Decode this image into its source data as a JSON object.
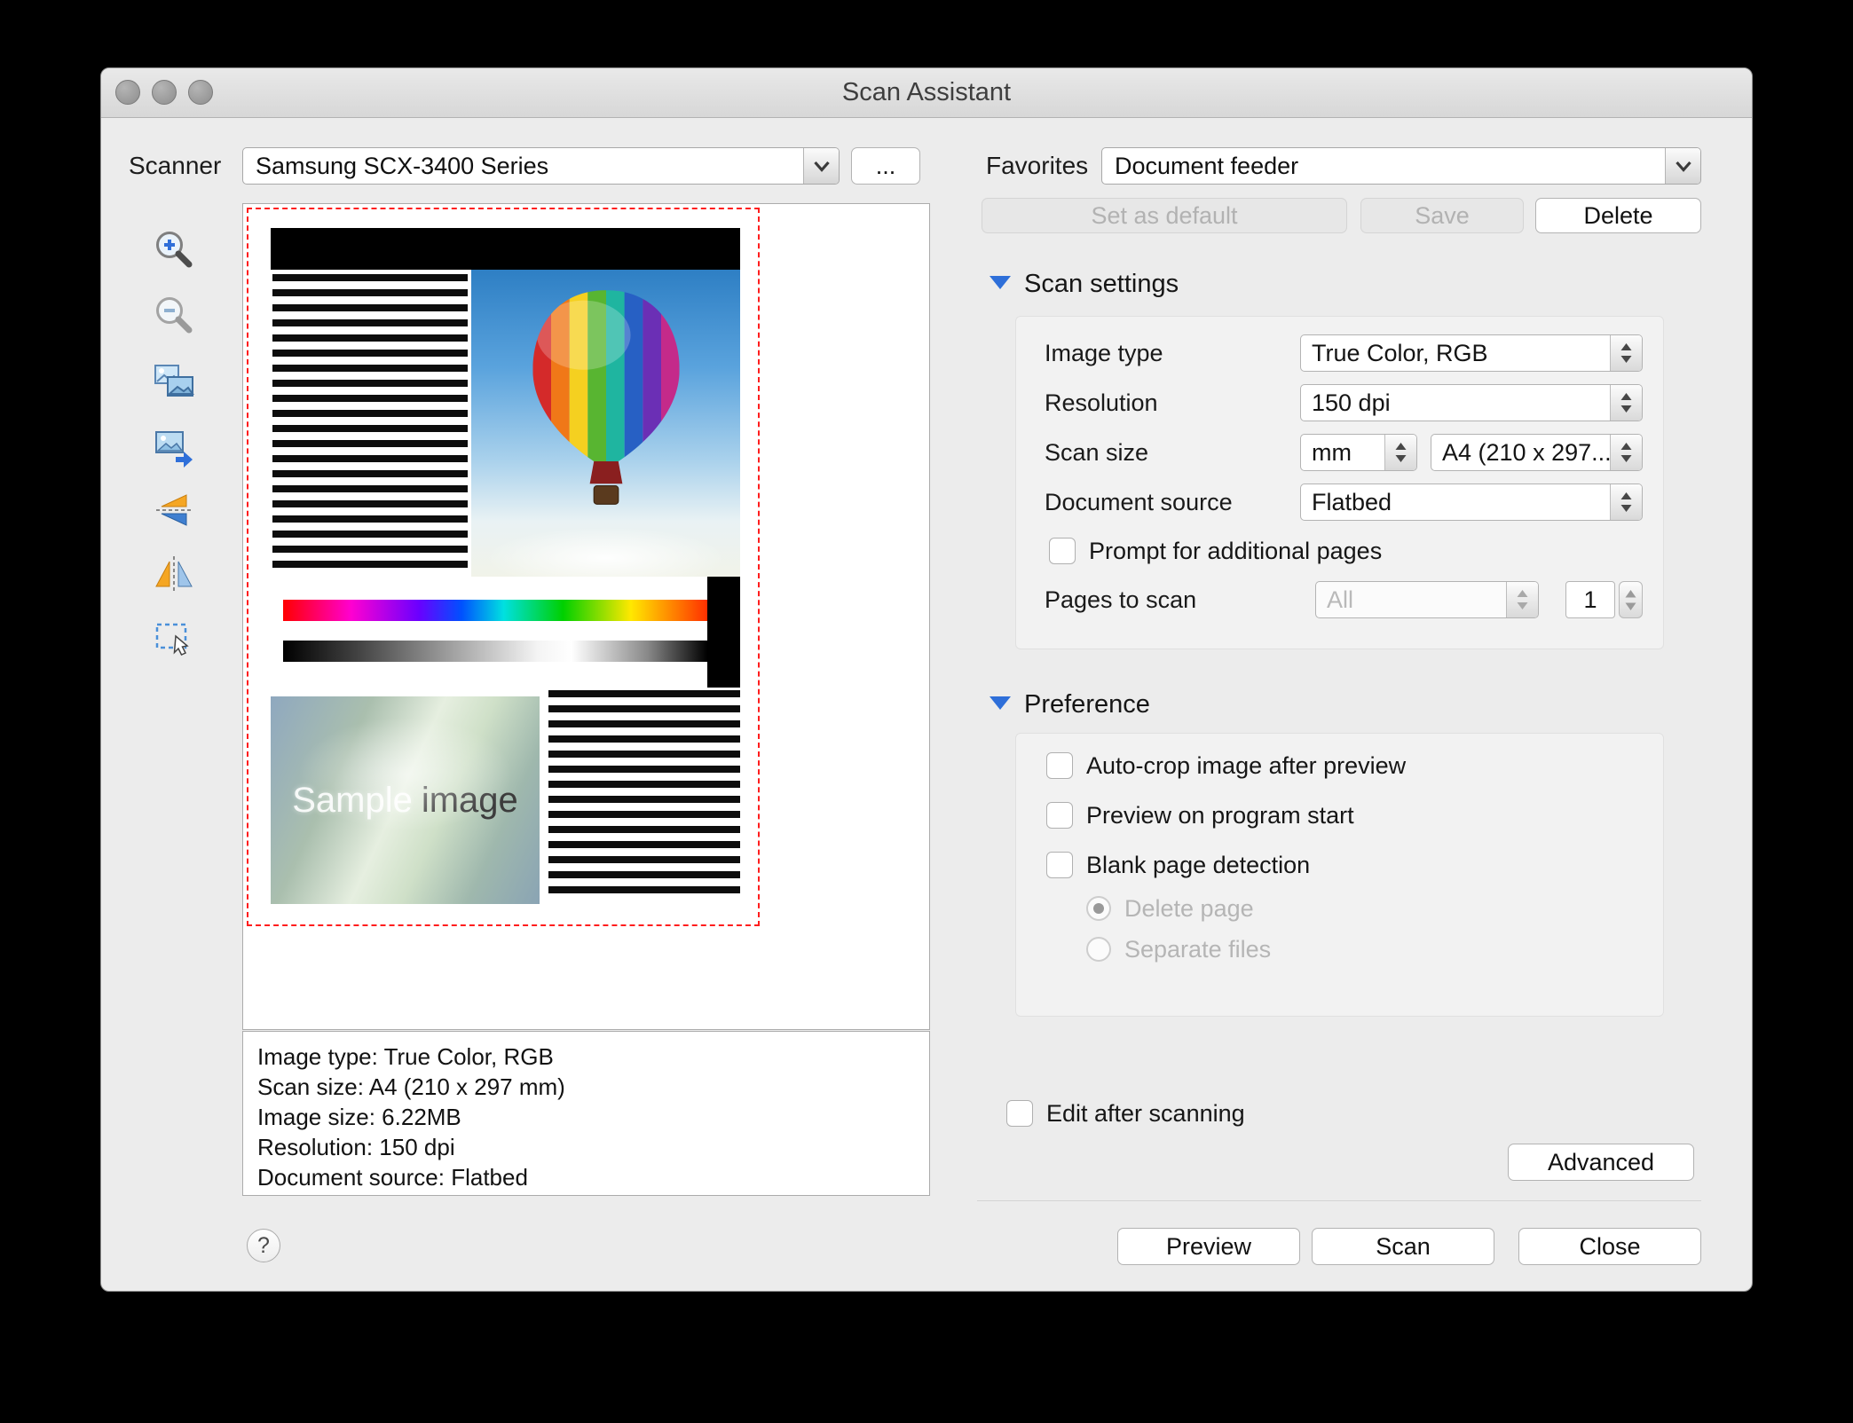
{
  "window": {
    "title": "Scan Assistant"
  },
  "scanner": {
    "label": "Scanner",
    "selected": "Samsung SCX-3400 Series",
    "browse_button": "...",
    "toolbar_icons": [
      "zoom-in",
      "zoom-out",
      "fit-to-window",
      "actual-size",
      "flip-vertical",
      "mirror-horizontal",
      "select-area"
    ]
  },
  "preview": {
    "sample_caption_light": "Sample",
    "sample_caption_dark": "image"
  },
  "scan_info": {
    "lines": [
      "Image type: True Color, RGB",
      "Scan size: A4 (210 x 297 mm)",
      "Image size: 6.22MB",
      "Resolution: 150 dpi",
      "Document source: Flatbed"
    ]
  },
  "help_button": "?",
  "favorites": {
    "label": "Favorites",
    "selected": "Document feeder",
    "set_default_button": "Set as default",
    "save_button": "Save",
    "delete_button": "Delete"
  },
  "scan_settings": {
    "section_title": "Scan settings",
    "image_type_label": "Image type",
    "image_type_value": "True Color, RGB",
    "resolution_label": "Resolution",
    "resolution_value": "150 dpi",
    "scan_size_label": "Scan size",
    "scan_size_unit": "mm",
    "scan_size_value": "A4 (210 x 297...",
    "document_source_label": "Document source",
    "document_source_value": "Flatbed",
    "prompt_label": "Prompt for additional pages",
    "prompt_checked": false,
    "pages_label": "Pages to scan",
    "pages_value": "All",
    "pages_count": "1"
  },
  "preference": {
    "section_title": "Preference",
    "auto_crop_label": "Auto-crop image after preview",
    "auto_crop_checked": false,
    "preview_start_label": "Preview on program start",
    "preview_start_checked": false,
    "blank_page_label": "Blank page detection",
    "blank_page_checked": false,
    "delete_page_label": "Delete page",
    "delete_page_selected": true,
    "separate_files_label": "Separate files",
    "separate_files_selected": false
  },
  "footer": {
    "edit_after_label": "Edit after scanning",
    "edit_after_checked": false,
    "advanced_button": "Advanced",
    "preview_button": "Preview",
    "scan_button": "Scan",
    "close_button": "Close"
  },
  "colors": {
    "selection_border": "#ff1d1d",
    "disclosure_triangle": "#2e6fd9",
    "window_background": "#ececec"
  }
}
